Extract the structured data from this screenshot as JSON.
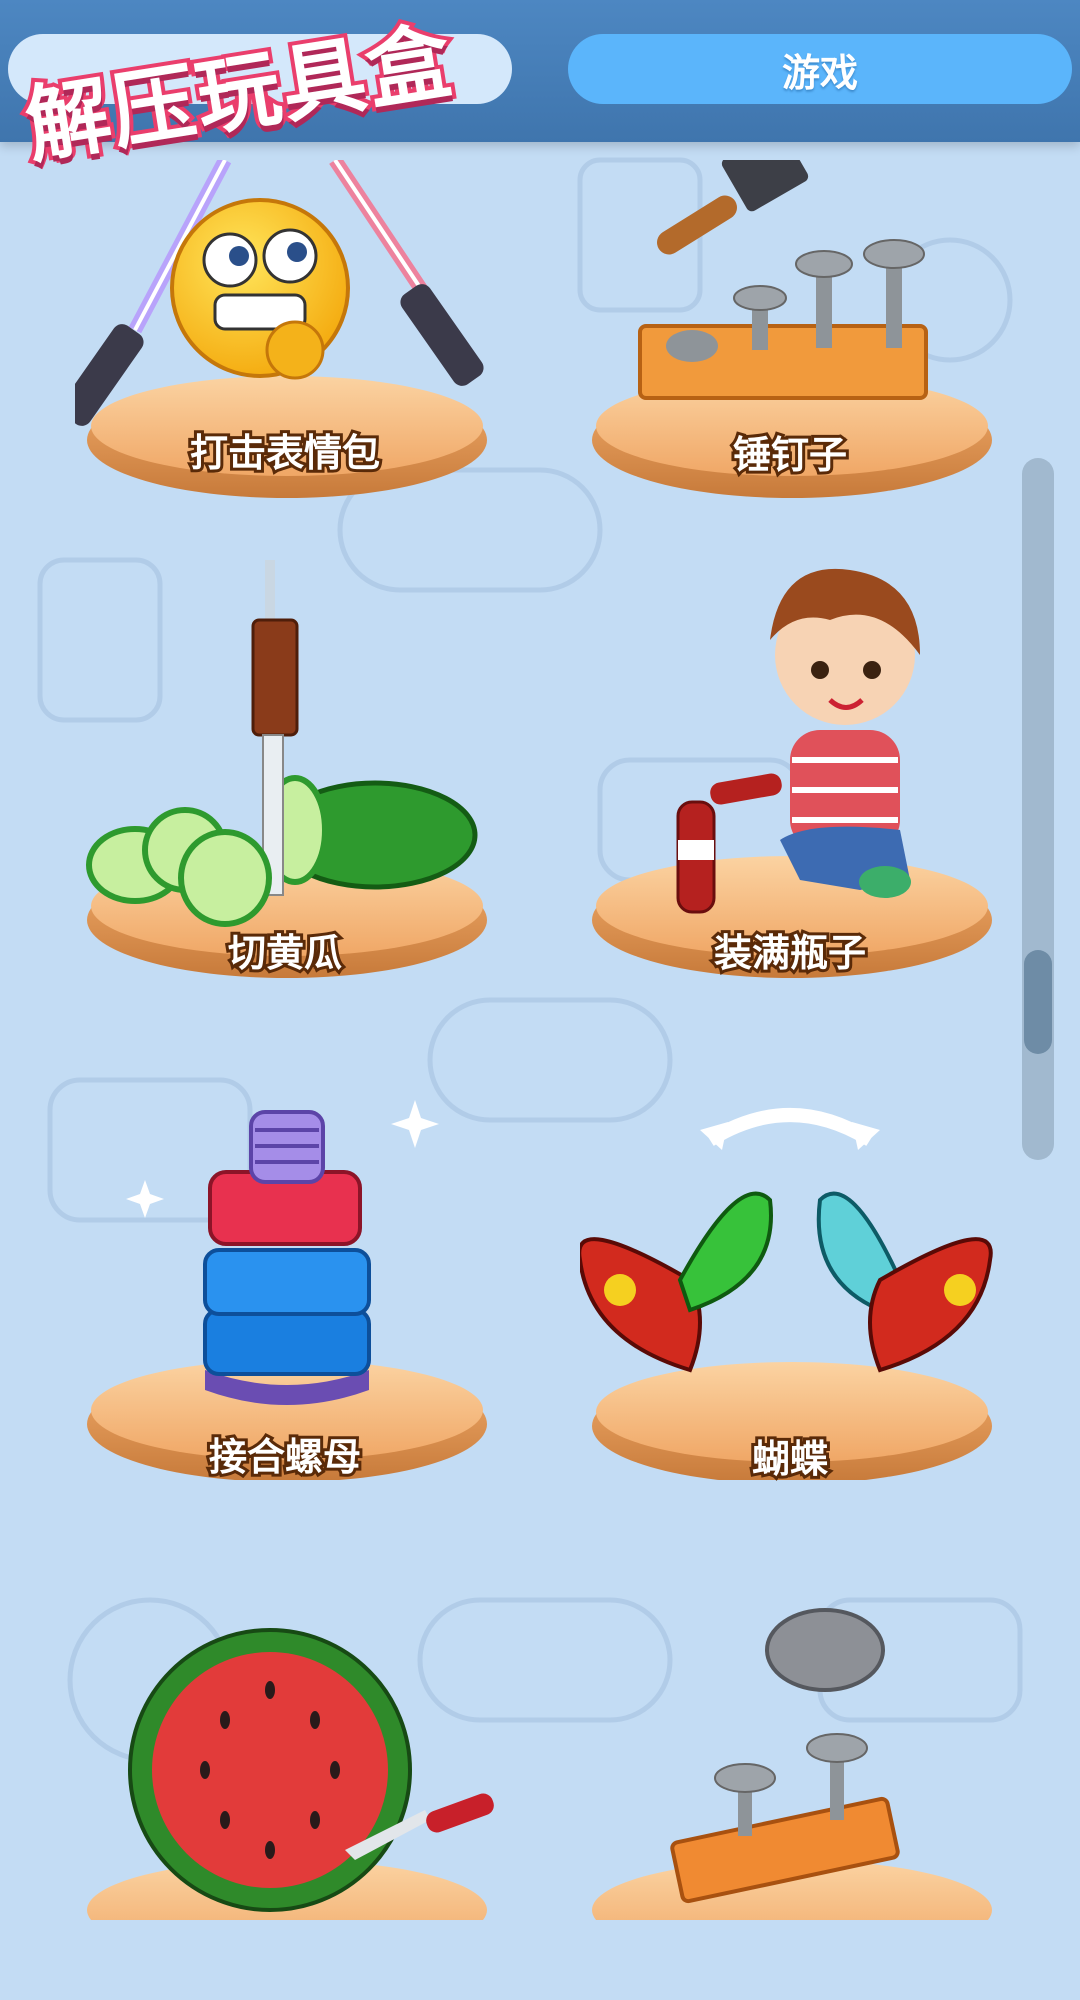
{
  "header": {
    "logo_text": "解压玩具盒",
    "tabs": [
      {
        "label": "",
        "active": false
      },
      {
        "label": "游戏",
        "active": true
      }
    ]
  },
  "games": [
    {
      "label": "打击表情包",
      "icon": "emoji-lightsaber-icon"
    },
    {
      "label": "锤钉子",
      "icon": "hammer-nails-icon"
    },
    {
      "label": "切黄瓜",
      "icon": "cucumber-knife-icon"
    },
    {
      "label": "装满瓶子",
      "icon": "boy-pouring-cola-icon"
    },
    {
      "label": "接合螺母",
      "icon": "bolt-nuts-icon"
    },
    {
      "label": "蝴蝶",
      "icon": "butterflies-icon"
    },
    {
      "label": "",
      "icon": "watermelon-knife-icon"
    },
    {
      "label": "",
      "icon": "rock-nails-icon"
    }
  ],
  "colors": {
    "background": "#c3dcf4",
    "header": "#4274ac",
    "active_tab": "#5bb5fb",
    "logo_stroke": "#ea3e6c",
    "pedestal": "#f3b577"
  }
}
